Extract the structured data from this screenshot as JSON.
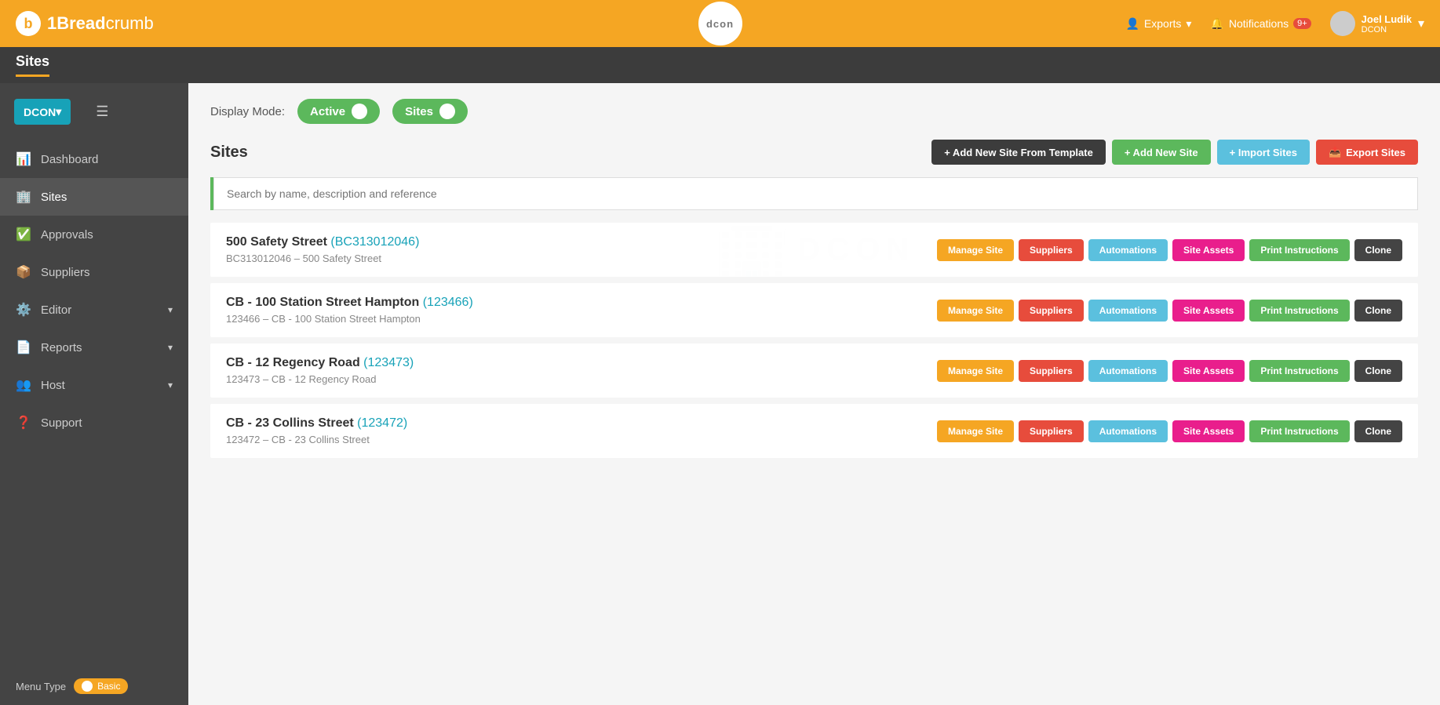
{
  "app": {
    "logo_symbol": "b",
    "logo_text_bold": "1Bread",
    "logo_text_normal": "crumb",
    "dcon_center_label": "dcon"
  },
  "header": {
    "exports_label": "Exports",
    "notifications_label": "Notifications",
    "notifications_count": "9+",
    "user_name": "Joel Ludik",
    "user_company": "DCON",
    "chevron": "▾"
  },
  "sub_header": {
    "title": "Sites"
  },
  "sidebar": {
    "dcon_btn": "DCON",
    "menu_toggle": "☰",
    "items": [
      {
        "id": "dashboard",
        "icon": "📊",
        "label": "Dashboard"
      },
      {
        "id": "sites",
        "icon": "🏢",
        "label": "Sites",
        "active": true
      },
      {
        "id": "approvals",
        "icon": "✅",
        "label": "Approvals"
      },
      {
        "id": "suppliers",
        "icon": "📦",
        "label": "Suppliers"
      },
      {
        "id": "editor",
        "icon": "⚙️",
        "label": "Editor",
        "has_chevron": true
      },
      {
        "id": "reports",
        "icon": "📄",
        "label": "Reports",
        "has_chevron": true
      },
      {
        "id": "host",
        "icon": "👥",
        "label": "Host",
        "has_chevron": true
      },
      {
        "id": "support",
        "icon": "❓",
        "label": "Support"
      }
    ],
    "menu_type_label": "Menu Type",
    "menu_type_value": "Basic"
  },
  "display_mode": {
    "label": "Display Mode:",
    "active_label": "Active",
    "sites_label": "Sites"
  },
  "sites_section": {
    "title": "Sites",
    "buttons": {
      "add_from_template": "+ Add New Site From Template",
      "add_new_site": "+ Add New Site",
      "import_sites": "+ Import Sites",
      "export_sites": "Export Sites"
    },
    "search_placeholder": "Search by name, description and reference",
    "sites": [
      {
        "name": "500 Safety Street",
        "ref_code": "BC313012046",
        "ref_line": "BC313012046 – 500 Safety Street"
      },
      {
        "name": "CB - 100 Station Street Hampton",
        "ref_code": "123466",
        "ref_line": "123466 – CB - 100 Station Street Hampton"
      },
      {
        "name": "CB - 12 Regency Road",
        "ref_code": "123473",
        "ref_line": "123473 – CB - 12 Regency Road"
      },
      {
        "name": "CB - 23 Collins Street",
        "ref_code": "123472",
        "ref_line": "123472 – CB - 23 Collins Street"
      }
    ],
    "site_action_buttons": {
      "manage_site": "Manage Site",
      "suppliers": "Suppliers",
      "automations": "Automations",
      "site_assets": "Site Assets",
      "print_instructions": "Print Instructions",
      "clone": "Clone"
    }
  }
}
